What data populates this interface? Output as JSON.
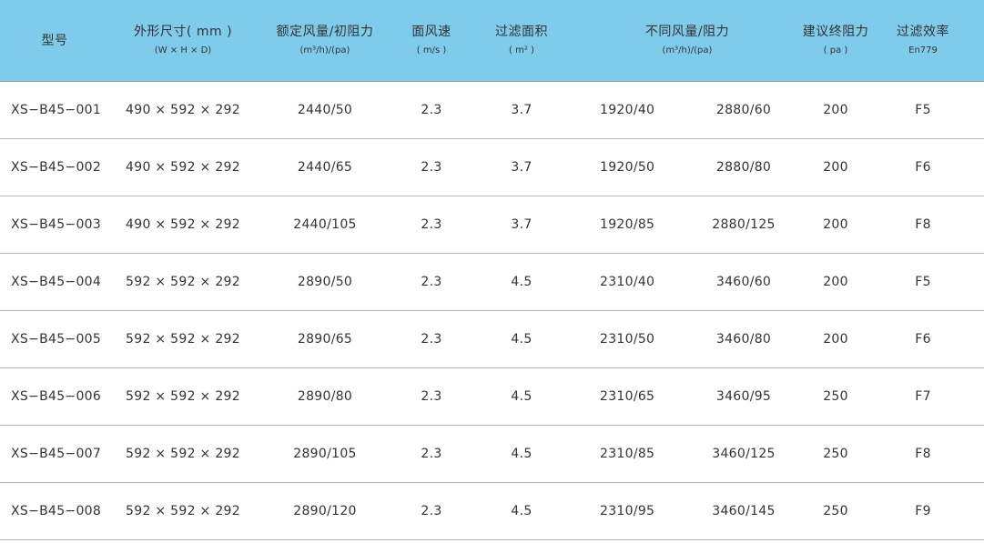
{
  "colors": {
    "header_bg": "#7fcbec",
    "row_divider": "#b7b7b7",
    "text": "#333333"
  },
  "header": {
    "model": "型号",
    "size": "外形尺寸( mm )",
    "size_sub": "(W × H × D)",
    "rated": "额定风量/初阻力",
    "rated_sub": "(m³/h)/(pa)",
    "velocity": "面风速",
    "velocity_sub": "( m/s )",
    "area": "过滤面积",
    "area_sub": "( m² )",
    "airflow": "不同风量/阻力",
    "airflow_sub": "(m³/h)/(pa)",
    "final": "建议终阻力",
    "final_sub": "( pa )",
    "efficiency": "过滤效率",
    "efficiency_sub": "En779"
  },
  "rows": [
    {
      "model": "XS−B45−001",
      "size": "490 × 592 × 292",
      "rated": "2440/50",
      "velocity": "2.3",
      "area": "3.7",
      "af1": "1920/40",
      "af2": "2880/60",
      "final": "200",
      "eff": "F5"
    },
    {
      "model": "XS−B45−002",
      "size": "490 × 592 × 292",
      "rated": "2440/65",
      "velocity": "2.3",
      "area": "3.7",
      "af1": "1920/50",
      "af2": "2880/80",
      "final": "200",
      "eff": "F6"
    },
    {
      "model": "XS−B45−003",
      "size": "490 × 592 × 292",
      "rated": "2440/105",
      "velocity": "2.3",
      "area": "3.7",
      "af1": "1920/85",
      "af2": "2880/125",
      "final": "200",
      "eff": "F8"
    },
    {
      "model": "XS−B45−004",
      "size": "592 × 592 × 292",
      "rated": "2890/50",
      "velocity": "2.3",
      "area": "4.5",
      "af1": "2310/40",
      "af2": "3460/60",
      "final": "200",
      "eff": "F5"
    },
    {
      "model": "XS−B45−005",
      "size": "592 × 592 × 292",
      "rated": "2890/65",
      "velocity": "2.3",
      "area": "4.5",
      "af1": "2310/50",
      "af2": "3460/80",
      "final": "200",
      "eff": "F6"
    },
    {
      "model": "XS−B45−006",
      "size": "592 × 592 × 292",
      "rated": "2890/80",
      "velocity": "2.3",
      "area": "4.5",
      "af1": "2310/65",
      "af2": "3460/95",
      "final": "250",
      "eff": "F7"
    },
    {
      "model": "XS−B45−007",
      "size": "592 × 592 × 292",
      "rated": "2890/105",
      "velocity": "2.3",
      "area": "4.5",
      "af1": "2310/85",
      "af2": "3460/125",
      "final": "250",
      "eff": "F8"
    },
    {
      "model": "XS−B45−008",
      "size": "592 × 592 × 292",
      "rated": "2890/120",
      "velocity": "2.3",
      "area": "4.5",
      "af1": "2310/95",
      "af2": "3460/145",
      "final": "250",
      "eff": "F9"
    }
  ]
}
